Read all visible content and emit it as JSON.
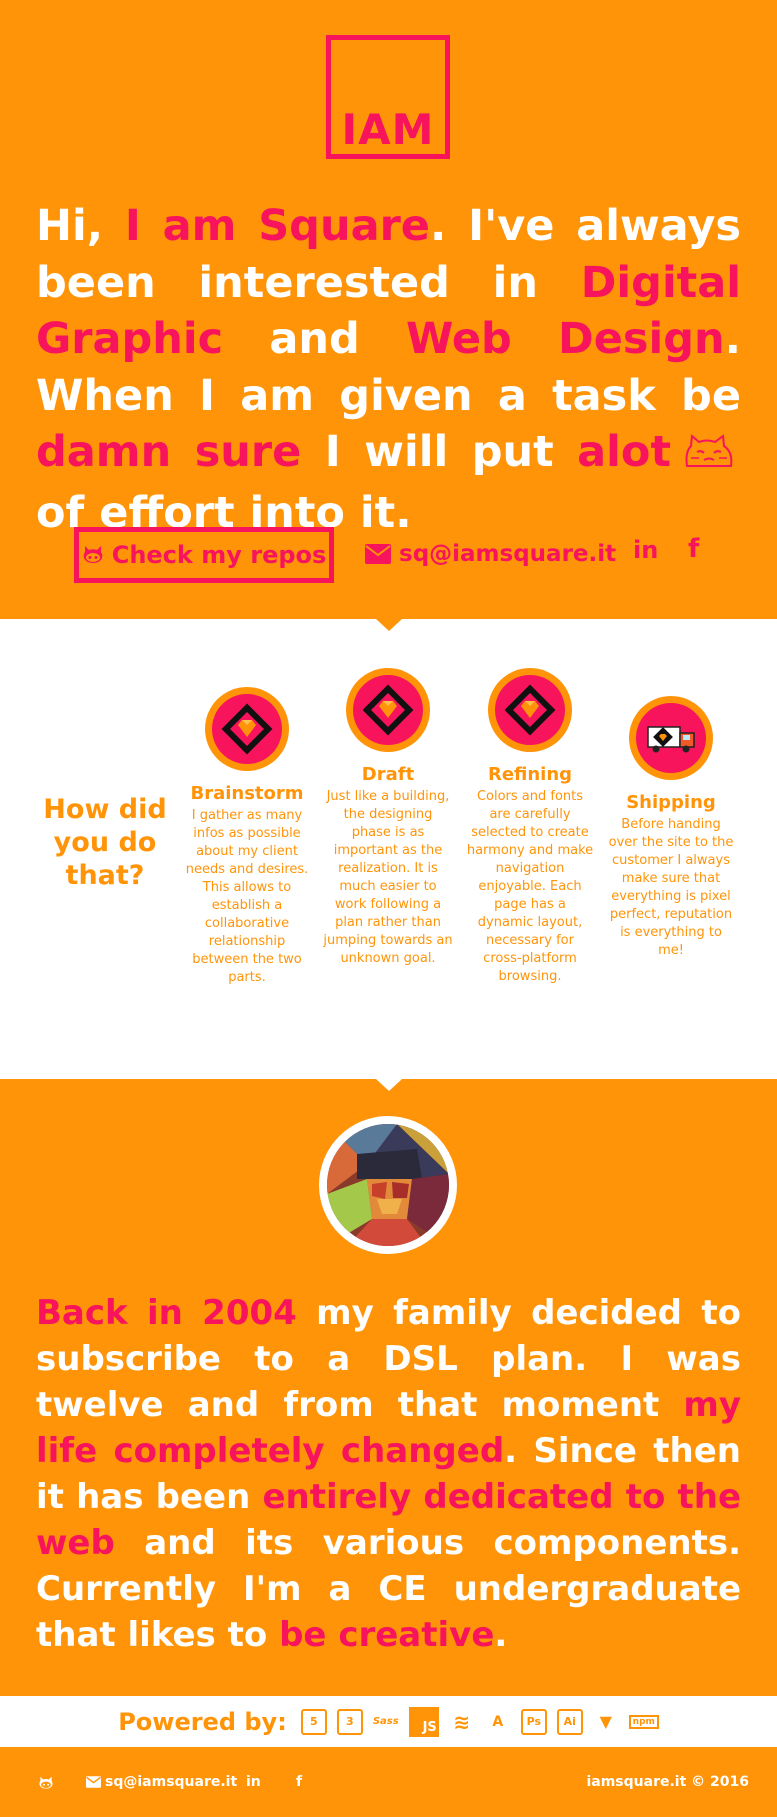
{
  "logo": {
    "text": "IAM"
  },
  "intro": {
    "parts": [
      {
        "text": "Hi, ",
        "hl": false
      },
      {
        "text": "I am Square",
        "hl": true
      },
      {
        "text": ". I've always been interested in ",
        "hl": false
      },
      {
        "text": "Digital Graphic",
        "hl": true
      },
      {
        "text": " and ",
        "hl": false
      },
      {
        "text": "Web Design",
        "hl": true
      },
      {
        "text": ". When I am given a task be ",
        "hl": false
      },
      {
        "text": "damn sure",
        "hl": true
      },
      {
        "text": " I will put ",
        "hl": false
      },
      {
        "text": "alot",
        "hl": true
      },
      {
        "text": " of effort into it.",
        "hl": false
      }
    ]
  },
  "links": {
    "repos_label": "Check my repos",
    "email": "sq@iamsquare.it",
    "linkedin": "in",
    "facebook": "f"
  },
  "process": {
    "heading": "How did you do that?",
    "steps": [
      {
        "title": "Brainstorm",
        "icon": "sketch-diamond-icon",
        "desc": "I gather as many infos as possible about my client needs and desires. This allows to establish a collaborative relationship between the two parts."
      },
      {
        "title": "Draft",
        "icon": "sketch-diamond-icon",
        "desc": "Just like a building, the designing phase is as important as the realization. It is much easier to work following a plan rather than jumping towards an unknown goal."
      },
      {
        "title": "Refining",
        "icon": "sketch-diamond-icon",
        "desc": "Colors and fonts are carefully selected to create harmony and make navigation enjoyable. Each page has a dynamic layout, necessary for cross-platform browsing."
      },
      {
        "title": "Shipping",
        "icon": "delivery-truck-icon",
        "desc": "Before handing over the site to the customer I always make sure that everything is pixel perfect, reputation is everything to me!"
      }
    ]
  },
  "about": {
    "parts": [
      {
        "text": "Back in 2004",
        "hl": true
      },
      {
        "text": " my family decided to subscribe to a DSL plan. I was twelve and from that moment ",
        "hl": false
      },
      {
        "text": "my life completely changed",
        "hl": true
      },
      {
        "text": ". Since then it has been ",
        "hl": false
      },
      {
        "text": "entirely dedicated to the web",
        "hl": true
      },
      {
        "text": " and its various components. Currently I'm a CE undergraduate that likes to ",
        "hl": false
      },
      {
        "text": "be creative",
        "hl": true
      },
      {
        "text": ".",
        "hl": false
      }
    ]
  },
  "powered": {
    "label": "Powered by:",
    "techs": [
      {
        "name": "html5-icon",
        "glyph": "5"
      },
      {
        "name": "css3-icon",
        "glyph": "3"
      },
      {
        "name": "sass-icon",
        "glyph": "Sass"
      },
      {
        "name": "javascript-icon",
        "glyph": "JS"
      },
      {
        "name": "jquery-icon",
        "glyph": "≋"
      },
      {
        "name": "angular-icon",
        "glyph": "A"
      },
      {
        "name": "photoshop-icon",
        "glyph": "Ps"
      },
      {
        "name": "illustrator-icon",
        "glyph": "Ai"
      },
      {
        "name": "gulp-icon",
        "glyph": "▼"
      },
      {
        "name": "npm-icon",
        "glyph": "npm"
      }
    ]
  },
  "footer": {
    "email": "sq@iamsquare.it",
    "linkedin": "in",
    "facebook": "f",
    "copyright": "iamsquare.it © 2016"
  },
  "colors": {
    "orange": "#ff9409",
    "pink": "#f7145c",
    "white": "#ffffff"
  }
}
